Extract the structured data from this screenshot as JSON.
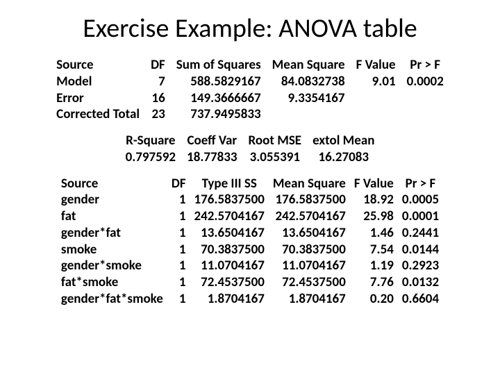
{
  "title": "Exercise Example: ANOVA table",
  "anova": {
    "headers": [
      "Source",
      "DF",
      "Sum of Squares",
      "Mean Square",
      "F Value",
      "Pr > F"
    ],
    "rows": [
      {
        "src": "Model",
        "df": "7",
        "ss": "588.5829167",
        "ms": "84.0832738",
        "f": "9.01",
        "p": "0.0002"
      },
      {
        "src": "Error",
        "df": "16",
        "ss": "149.3666667",
        "ms": "9.3354167",
        "f": "",
        "p": ""
      },
      {
        "src": "Corrected Total",
        "df": "23",
        "ss": "737.9495833",
        "ms": "",
        "f": "",
        "p": ""
      }
    ]
  },
  "fit": {
    "headers": [
      "R-Square",
      "Coeff Var",
      "Root MSE",
      "extol Mean"
    ],
    "values": [
      "0.797592",
      "18.77833",
      "3.055391",
      "16.27083"
    ]
  },
  "type3": {
    "headers": [
      "Source",
      "DF",
      "Type III SS",
      "Mean Square",
      "F Value",
      "Pr > F"
    ],
    "rows": [
      {
        "src": "gender",
        "df": "1",
        "ss": "176.5837500",
        "ms": "176.5837500",
        "f": "18.92",
        "p": "0.0005"
      },
      {
        "src": "fat",
        "df": "1",
        "ss": "242.5704167",
        "ms": "242.5704167",
        "f": "25.98",
        "p": "0.0001"
      },
      {
        "src": "gender*fat",
        "df": "1",
        "ss": "13.6504167",
        "ms": "13.6504167",
        "f": "1.46",
        "p": "0.2441"
      },
      {
        "src": "smoke",
        "df": "1",
        "ss": "70.3837500",
        "ms": "70.3837500",
        "f": "7.54",
        "p": "0.0144"
      },
      {
        "src": "gender*smoke",
        "df": "1",
        "ss": "11.0704167",
        "ms": "11.0704167",
        "f": "1.19",
        "p": "0.2923"
      },
      {
        "src": "fat*smoke",
        "df": "1",
        "ss": "72.4537500",
        "ms": "72.4537500",
        "f": "7.76",
        "p": "0.0132"
      },
      {
        "src": "gender*fat*smoke",
        "df": "1",
        "ss": "1.8704167",
        "ms": "1.8704167",
        "f": "0.20",
        "p": "0.6604"
      }
    ]
  }
}
